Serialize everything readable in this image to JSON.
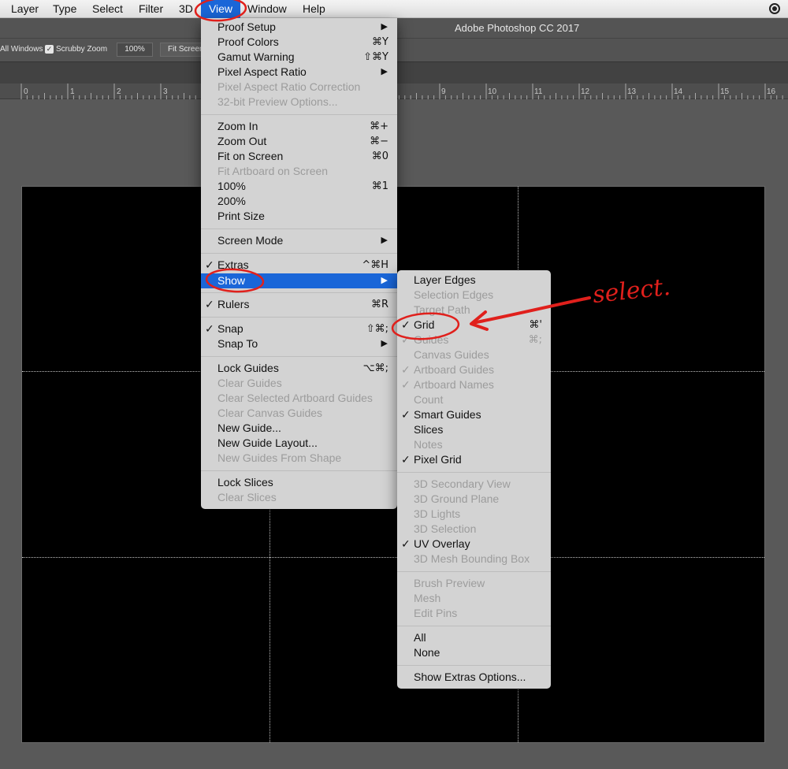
{
  "menubar": {
    "items": [
      "Layer",
      "Type",
      "Select",
      "Filter",
      "3D",
      "View",
      "Window",
      "Help"
    ],
    "right_icon": "creative-cloud-icon"
  },
  "titlebar": {
    "title": "Adobe Photoshop CC 2017"
  },
  "options": {
    "all_windows": "All Windows",
    "scrubby_zoom": "Scrubby Zoom",
    "scrubby_checked": true,
    "zoom_value": "100%",
    "fit_screen": "Fit Screen"
  },
  "ruler": {
    "numbers": [
      "0",
      "1",
      "2",
      "3",
      "9",
      "10",
      "11",
      "12",
      "13",
      "14",
      "15",
      "16"
    ]
  },
  "view_menu": {
    "items": [
      {
        "label": "Proof Setup",
        "submenu": true
      },
      {
        "label": "Proof Colors",
        "shortcut": "⌘Y"
      },
      {
        "label": "Gamut Warning",
        "shortcut": "⇧⌘Y"
      },
      {
        "label": "Pixel Aspect Ratio",
        "submenu": true
      },
      {
        "label": "Pixel Aspect Ratio Correction",
        "disabled": true
      },
      {
        "label": "32-bit Preview Options...",
        "disabled": true
      },
      {
        "separator": true
      },
      {
        "label": "Zoom In",
        "shortcut": "⌘+"
      },
      {
        "label": "Zoom Out",
        "shortcut": "⌘−"
      },
      {
        "label": "Fit on Screen",
        "shortcut": "⌘0"
      },
      {
        "label": "Fit Artboard on Screen",
        "disabled": true
      },
      {
        "label": "100%",
        "shortcut": "⌘1"
      },
      {
        "label": "200%"
      },
      {
        "label": "Print Size"
      },
      {
        "separator": true
      },
      {
        "label": "Screen Mode",
        "submenu": true
      },
      {
        "separator": true
      },
      {
        "label": "Extras",
        "checked": true,
        "shortcut": "^⌘H"
      },
      {
        "label": "Show",
        "submenu": true,
        "highlighted": true
      },
      {
        "separator": true
      },
      {
        "label": "Rulers",
        "checked": true,
        "shortcut": "⌘R"
      },
      {
        "separator": true
      },
      {
        "label": "Snap",
        "checked": true,
        "shortcut": "⇧⌘;"
      },
      {
        "label": "Snap To",
        "submenu": true
      },
      {
        "separator": true
      },
      {
        "label": "Lock Guides",
        "shortcut": "⌥⌘;"
      },
      {
        "label": "Clear Guides",
        "disabled": true
      },
      {
        "label": "Clear Selected Artboard Guides",
        "disabled": true
      },
      {
        "label": "Clear Canvas Guides",
        "disabled": true
      },
      {
        "label": "New Guide..."
      },
      {
        "label": "New Guide Layout..."
      },
      {
        "label": "New Guides From Shape",
        "disabled": true
      },
      {
        "separator": true
      },
      {
        "label": "Lock Slices"
      },
      {
        "label": "Clear Slices",
        "disabled": true
      }
    ]
  },
  "show_menu": {
    "items": [
      {
        "label": "Layer Edges"
      },
      {
        "label": "Selection Edges",
        "disabled": true
      },
      {
        "label": "Target Path",
        "disabled": true
      },
      {
        "label": "Grid",
        "checked": true,
        "shortcut": "⌘'"
      },
      {
        "label": "Guides",
        "checked": true,
        "disabled": true,
        "shortcut": "⌘;"
      },
      {
        "label": "Canvas Guides",
        "disabled": true
      },
      {
        "label": "Artboard Guides",
        "checked": true,
        "disabled": true
      },
      {
        "label": "Artboard Names",
        "checked": true,
        "disabled": true
      },
      {
        "label": "Count",
        "disabled": true
      },
      {
        "label": "Smart Guides",
        "checked": true
      },
      {
        "label": "Slices"
      },
      {
        "label": "Notes",
        "disabled": true
      },
      {
        "label": "Pixel Grid",
        "checked": true
      },
      {
        "separator": true
      },
      {
        "label": "3D Secondary View",
        "disabled": true
      },
      {
        "label": "3D Ground Plane",
        "disabled": true
      },
      {
        "label": "3D Lights",
        "disabled": true
      },
      {
        "label": "3D Selection",
        "disabled": true
      },
      {
        "label": "UV Overlay",
        "checked": true
      },
      {
        "label": "3D Mesh Bounding Box",
        "disabled": true
      },
      {
        "separator": true
      },
      {
        "label": "Brush Preview",
        "disabled": true
      },
      {
        "label": "Mesh",
        "disabled": true
      },
      {
        "label": "Edit Pins",
        "disabled": true
      },
      {
        "separator": true
      },
      {
        "label": "All"
      },
      {
        "label": "None"
      },
      {
        "separator": true
      },
      {
        "label": "Show Extras Options..."
      }
    ]
  },
  "annotation": {
    "text": "select.",
    "color": "#e0201c"
  },
  "colors": {
    "accent": "#1a66d8",
    "menu_bg": "#d3d3d3",
    "canvas": "#000000"
  }
}
